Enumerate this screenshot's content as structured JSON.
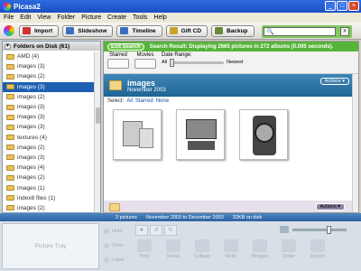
{
  "window": {
    "title": "Picasa2"
  },
  "menu": [
    "File",
    "Edit",
    "View",
    "Folder",
    "Picture",
    "Create",
    "Tools",
    "Help"
  ],
  "toolbar": {
    "buttons": [
      {
        "label": "Import",
        "color": "#c33"
      },
      {
        "label": "Slideshow",
        "color": "#3a6fbf"
      },
      {
        "label": "Timeline",
        "color": "#3a6fbf"
      },
      {
        "label": "Gift CD",
        "color": "#c9a32a"
      },
      {
        "label": "Backup",
        "color": "#6a8a3a"
      }
    ]
  },
  "sidebar": {
    "header": "Folders on Disk (61)",
    "items": [
      {
        "label": "AMD (4)"
      },
      {
        "label": "images (3)"
      },
      {
        "label": "images (2)"
      },
      {
        "label": "images (3)",
        "selected": true
      },
      {
        "label": "images (2)"
      },
      {
        "label": "images (3)"
      },
      {
        "label": "images (3)"
      },
      {
        "label": "images (3)"
      },
      {
        "label": "textures (4)"
      },
      {
        "label": "images (2)"
      },
      {
        "label": "images (3)"
      },
      {
        "label": "images (4)"
      },
      {
        "label": "images (2)"
      },
      {
        "label": "images (1)"
      },
      {
        "label": "index8 files (1)"
      },
      {
        "label": "images (2)"
      }
    ]
  },
  "search_result": {
    "exit_label": "Exit Search",
    "text": "Search Result: Displaying 2665 pictures in 272 albums (0.005 seconds)."
  },
  "filters": {
    "starred_label": "Starred",
    "movies_label": "Movies",
    "date_range_label": "Date Range:",
    "all_label": "All",
    "newest_label": "Newest"
  },
  "album": {
    "title": "images",
    "date": "November 2003",
    "actions_label": "Actions",
    "select_label": "Select:",
    "select_links": [
      "All",
      "Starred",
      "None"
    ]
  },
  "status": {
    "count": "3 pictures",
    "date_range": "November 2003 to December 2003",
    "size": "32KB on disk"
  },
  "tray": {
    "label": "Picture Tray",
    "side_buttons": [
      "Hold",
      "Clear",
      "Label"
    ],
    "actions": [
      "Print",
      "Email",
      "Collage",
      "Hello",
      "Blogger",
      "Order",
      "Export"
    ]
  }
}
